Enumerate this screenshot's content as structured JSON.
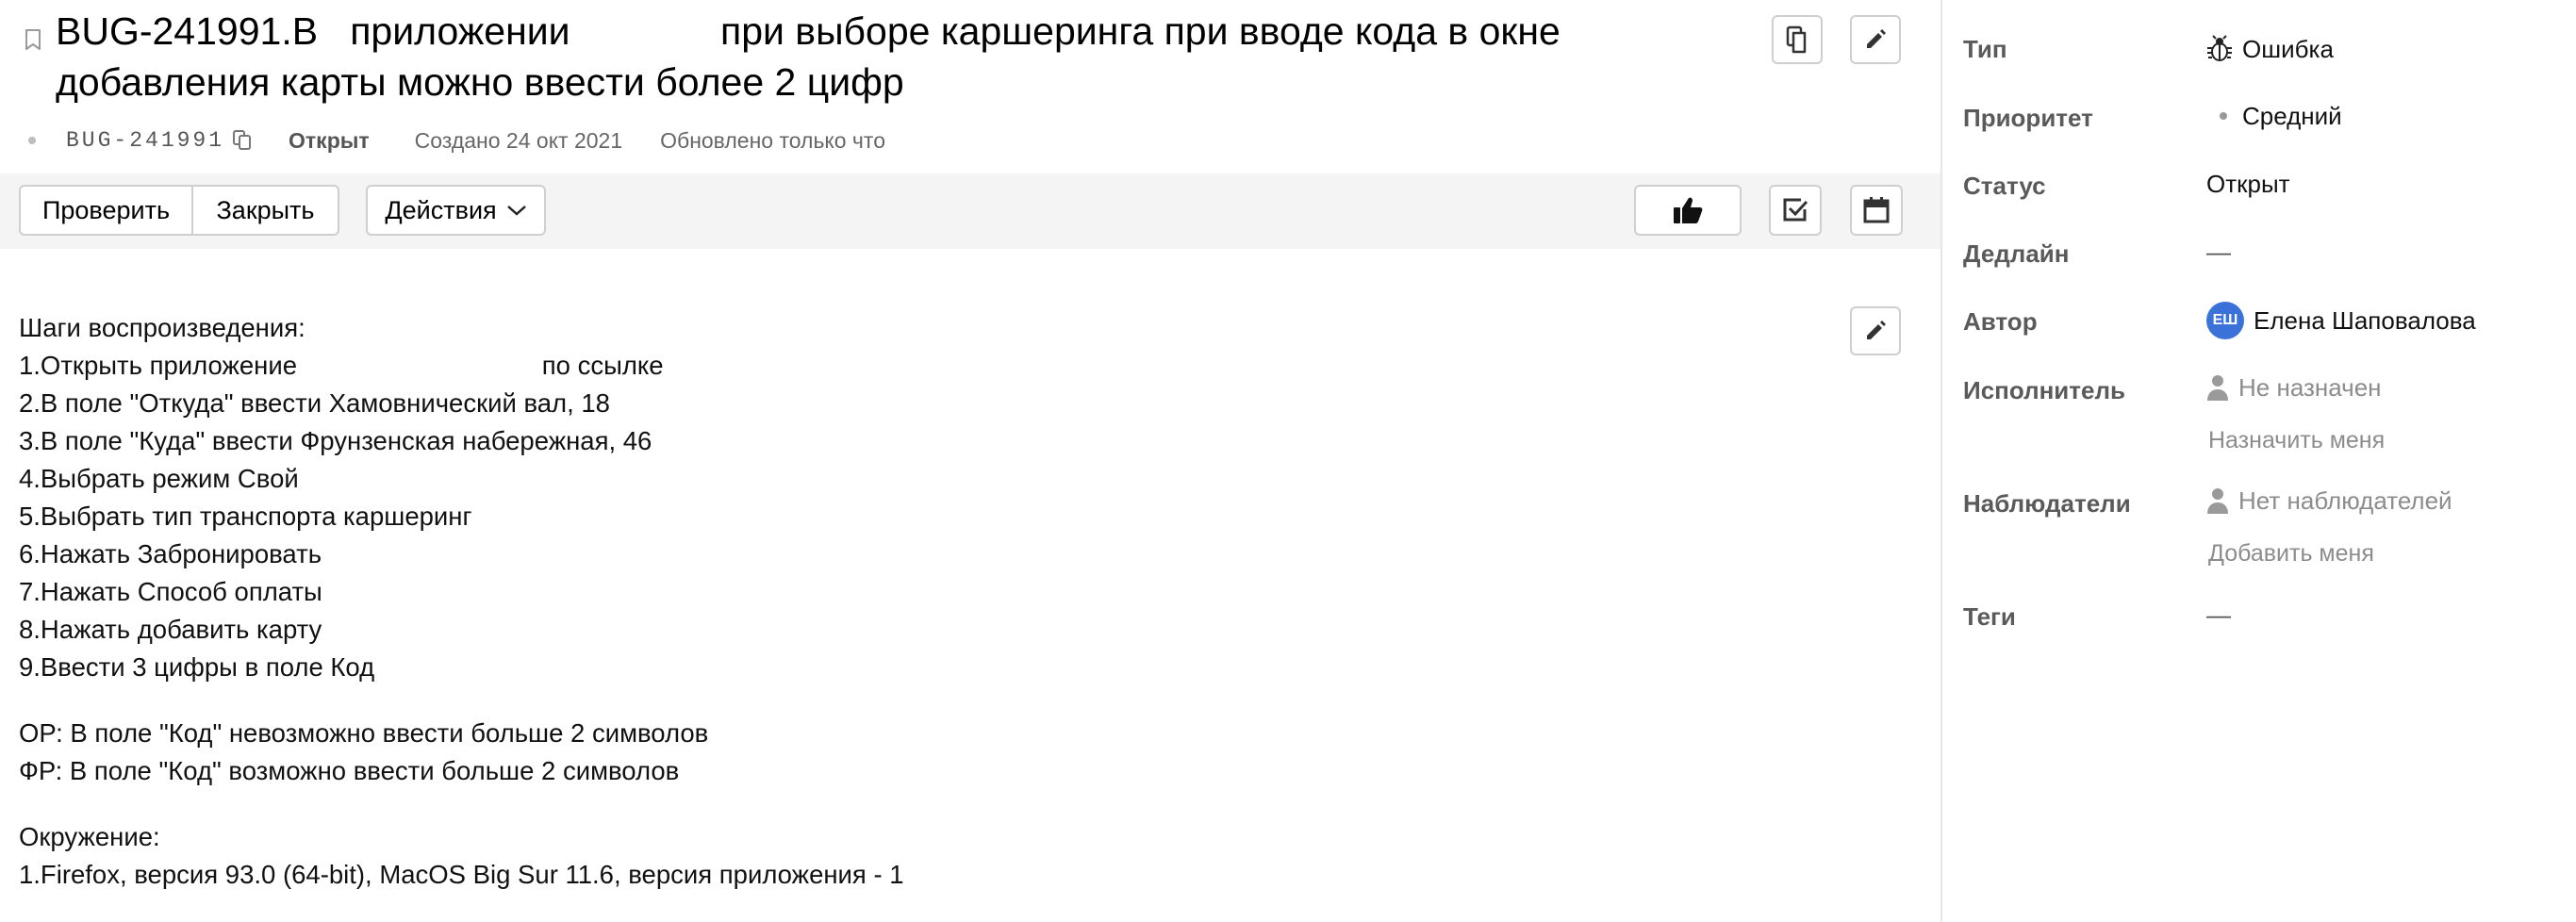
{
  "issue": {
    "title": "BUG-241991.В   приложении              при выборе каршеринга при вводе кода в окне добавления карты можно ввести более 2 цифр",
    "key": "BUG-241991",
    "status": "Открыт",
    "created": "Создано 24 окт 2021",
    "updated": "Обновлено только что"
  },
  "toolbar": {
    "check_label": "Проверить",
    "close_label": "Закрыть",
    "actions_label": "Действия"
  },
  "description": {
    "steps_heading": "Шаги воспроизведения:",
    "steps": [
      "1.Открыть приложение                                  по ссылке",
      "2.В поле \"Откуда\" ввести Хамовнический вал, 18",
      "3.В поле \"Куда\" ввести Фрунзенская набережная, 46",
      "4.Выбрать режим Свой",
      "5.Выбрать тип транспорта каршеринг",
      "6.Нажать Забронировать",
      "7.Нажать Способ оплаты",
      "8.Нажать добавить карту",
      "9.Ввести 3 цифры в поле Код"
    ],
    "expected": "ОР: В поле \"Код\" невозможно ввести больше 2 символов",
    "actual": "ФР: В поле \"Код\" возможно ввести больше 2 символов",
    "env_heading": "Окружение:",
    "env_line": "1.Firefox, версия 93.0 (64-bit), MacOS Big Sur 11.6, версия приложения - 1"
  },
  "sidebar": {
    "type_label": "Тип",
    "type_value": "Ошибка",
    "priority_label": "Приоритет",
    "priority_value": "Средний",
    "status_label": "Статус",
    "status_value": "Открыт",
    "deadline_label": "Дедлайн",
    "deadline_value": "—",
    "author_label": "Автор",
    "author_initials": "ЕШ",
    "author_name": "Елена Шаповалова",
    "assignee_label": "Исполнитель",
    "assignee_value": "Не назначен",
    "assign_me": "Назначить меня",
    "watchers_label": "Наблюдатели",
    "watchers_value": "Нет наблюдателей",
    "add_me": "Добавить меня",
    "tags_label": "Теги",
    "tags_value": "—"
  },
  "icons": {
    "bookmark": "bookmark-icon",
    "copy": "copy-icon",
    "edit": "pencil-icon",
    "like": "thumbs-up-icon",
    "checklist": "checkbox-icon",
    "calendar": "calendar-icon",
    "chevron": "chevron-down-icon",
    "bug": "bug-icon",
    "person": "person-icon"
  },
  "colors": {
    "avatar_bg": "#3b72d9",
    "toolbar_bg": "#f4f4f4",
    "muted_text": "#8c8c8c"
  }
}
